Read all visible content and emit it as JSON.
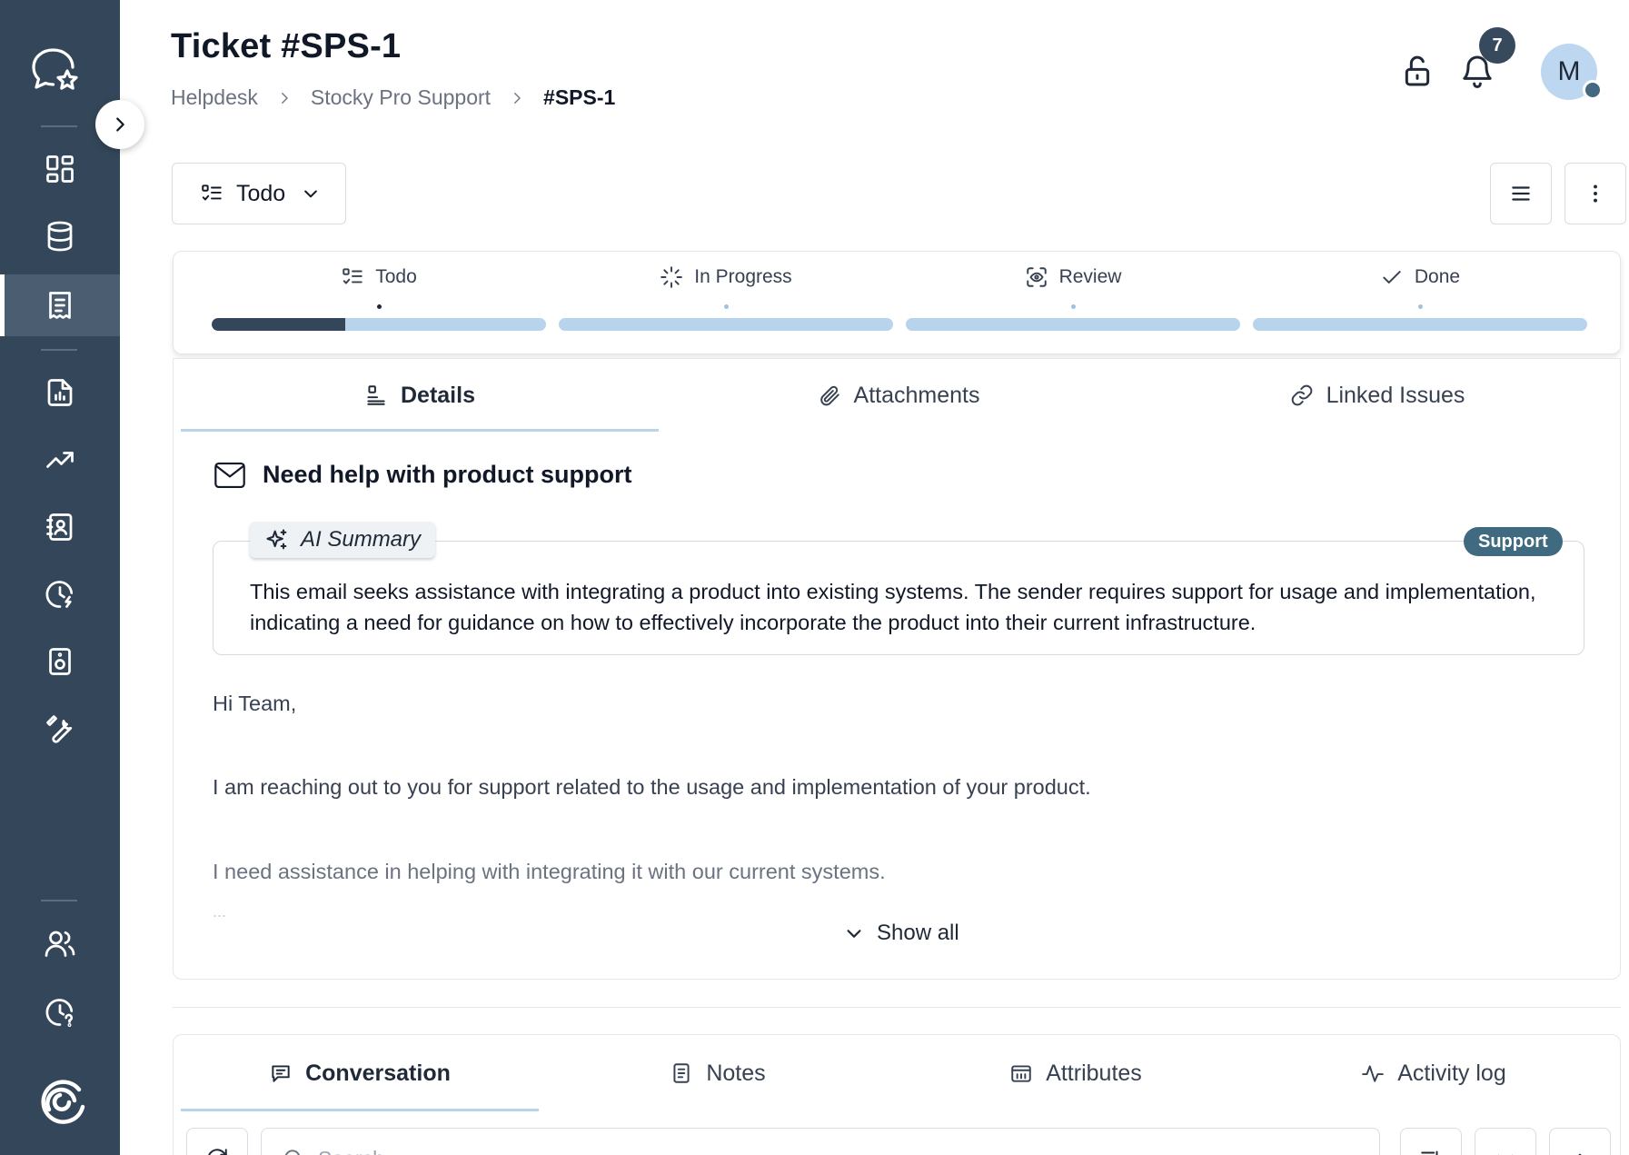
{
  "header": {
    "title": "Ticket #SPS-1",
    "breadcrumb": [
      "Helpdesk",
      "Stocky Pro Support",
      "#SPS-1"
    ],
    "notification_count": "7",
    "avatar_initial": "M"
  },
  "toolbar": {
    "status_label": "Todo"
  },
  "steps": [
    {
      "label": "Todo",
      "icon": "todo-list-icon",
      "progress": 0.4
    },
    {
      "label": "In Progress",
      "icon": "loader-icon",
      "progress": 0
    },
    {
      "label": "Review",
      "icon": "eye-scan-icon",
      "progress": 0
    },
    {
      "label": "Done",
      "icon": "check-icon",
      "progress": 0
    }
  ],
  "detail_tabs": [
    {
      "label": "Details",
      "icon": "details-icon",
      "active": true
    },
    {
      "label": "Attachments",
      "icon": "paperclip-icon",
      "active": false
    },
    {
      "label": "Linked Issues",
      "icon": "link-icon",
      "active": false
    }
  ],
  "ticket": {
    "subject": "Need help with product support",
    "ai_summary_label": "AI Summary",
    "category": "Support",
    "summary": "This email seeks assistance with integrating a product into existing systems. The sender requires support for usage and implementation, indicating a need for guidance on how to effectively incorporate the product into their current infrastructure.",
    "body": [
      "Hi Team,",
      "I am reaching out to you for support related to the usage and implementation of your product.",
      "I need assistance in helping with integrating it with our current systems."
    ],
    "ellipsis": "...",
    "show_all_label": "Show all"
  },
  "conversation_tabs": [
    {
      "label": "Conversation",
      "icon": "chat-icon",
      "active": true
    },
    {
      "label": "Notes",
      "icon": "note-icon",
      "active": false
    },
    {
      "label": "Attributes",
      "icon": "attributes-icon",
      "active": false
    },
    {
      "label": "Activity log",
      "icon": "activity-icon",
      "active": false
    }
  ],
  "conversation": {
    "search_placeholder": "Search"
  },
  "colors": {
    "sidebar": "#34475a",
    "accent": "#33465a",
    "progress_track": "#b8d3ec",
    "badge": "#3f6a80"
  }
}
